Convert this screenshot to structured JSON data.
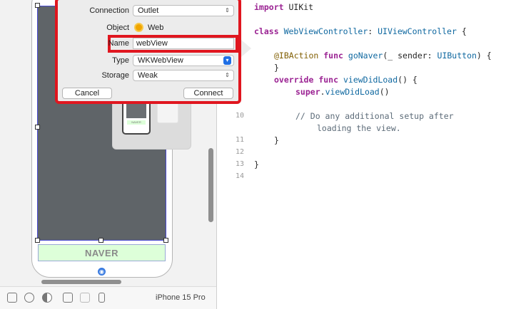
{
  "connection_popover": {
    "connection_label": "Connection",
    "connection_value": "Outlet",
    "object_label": "Object",
    "object_value": "Web",
    "name_label": "Name",
    "name_value": "webView",
    "type_label": "Type",
    "type_value": "WKWebView",
    "storage_label": "Storage",
    "storage_value": "Weak",
    "cancel_label": "Cancel",
    "connect_label": "Connect"
  },
  "canvas": {
    "button_label": "NAVER",
    "thumbnail_button_label": "NAVER"
  },
  "toolbar": {
    "device": "iPhone 15 Pro"
  },
  "editor": {
    "lines": [
      {
        "n": "",
        "text": "import UIKit"
      },
      {
        "n": "",
        "text": "class WebViewController: UIViewController {"
      },
      {
        "n": "",
        "text": "@IBAction func goNaver(_ sender: UIButton) {"
      },
      {
        "n": "",
        "text": "}"
      },
      {
        "n": "",
        "text": "override func viewDidLoad() {"
      },
      {
        "n": "",
        "text": "super.viewDidLoad()"
      },
      {
        "n": "10",
        "text": "// Do any additional setup after"
      },
      {
        "n": "",
        "text": "loading the view."
      },
      {
        "n": "11",
        "text": "}"
      },
      {
        "n": "12",
        "text": ""
      },
      {
        "n": "13",
        "text": "}"
      },
      {
        "n": "14",
        "text": ""
      }
    ]
  },
  "colors": {
    "highlight_red": "#e0161f",
    "keyword": "#9b2393",
    "type": "#0f68a0",
    "comment": "#5d6c79",
    "button_bg": "#ddffd9"
  }
}
